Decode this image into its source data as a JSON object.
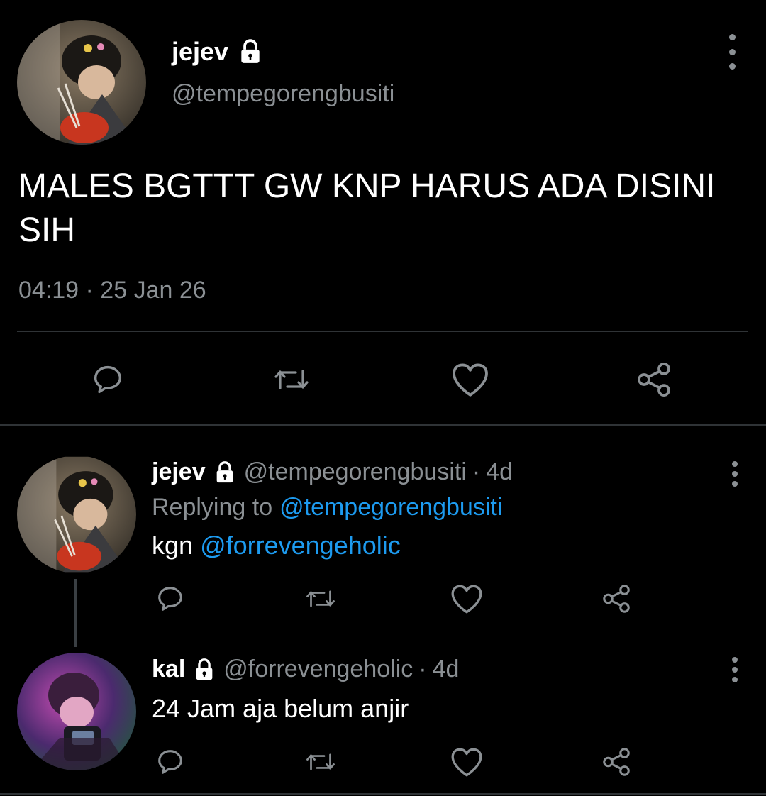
{
  "main_tweet": {
    "display_name": "jejev",
    "handle": "@tempegorengbusiti",
    "text": "MALES BGTTT GW KNP HARUS ADA DISINI SIH",
    "timestamp": "04:19 · 25 Jan 26",
    "icons": [
      "lock-icon",
      "more-icon",
      "reply-icon",
      "retweet-icon",
      "like-icon",
      "share-icon"
    ]
  },
  "replies": [
    {
      "display_name": "jejev",
      "handle": "@tempegorengbusiti",
      "time_sep": "·",
      "age": "4d",
      "replying_prefix": "Replying to",
      "replying_to": "@tempegorengbusiti",
      "body_text": "kgn",
      "body_mention": "@forrevengeholic"
    },
    {
      "display_name": "kal",
      "handle": "@forrevengeholic",
      "time_sep": "·",
      "age": "4d",
      "body_text": "24 Jam aja belum anjir"
    }
  ],
  "colors": {
    "background": "#000000",
    "text": "#e7e9ea",
    "muted": "#8b9094",
    "link": "#1d9bf0",
    "divider": "#2f3336"
  }
}
